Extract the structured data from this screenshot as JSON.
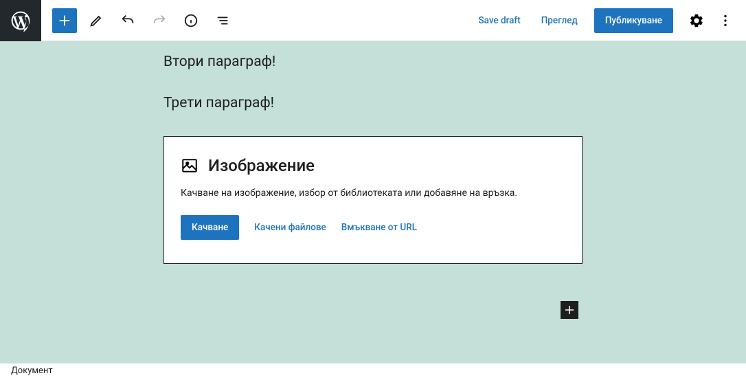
{
  "header": {
    "save_draft": "Save draft",
    "preview": "Преглед",
    "publish": "Публикуване"
  },
  "content": {
    "paragraphs": [
      "Втори параграф!",
      "Трети параграф!"
    ]
  },
  "image_block": {
    "title": "Изображение",
    "description": "Качване на изображение, избор от библиотеката или добавяне на връзка.",
    "upload": "Качване",
    "media_library": "Качени файлове",
    "from_url": "Вмъкване от URL"
  },
  "footer": {
    "breadcrumb": "Документ"
  }
}
